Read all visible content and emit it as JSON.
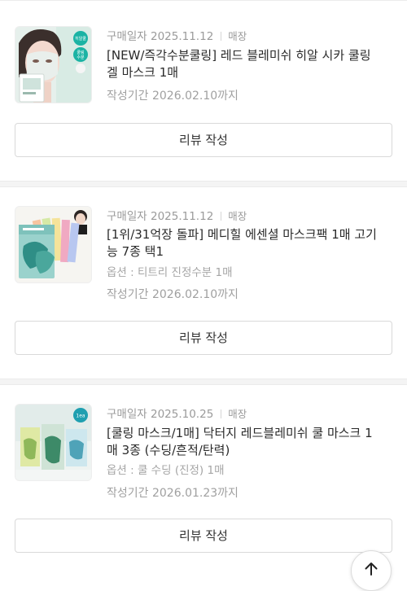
{
  "orders": [
    {
      "date_label": "구매일자",
      "date": "2025.11.12",
      "store": "매장",
      "title": "[NEW/즉각수분쿨링] 레드 블레미쉬 히알 시카 쿨링 겔 마스크 1매",
      "option": "",
      "period_label": "작성기간",
      "period": "2026.02.10까지",
      "review_button": "리뷰 작성",
      "thumb_badges": [
        "히알쿨",
        "쿨링",
        "수분"
      ]
    },
    {
      "date_label": "구매일자",
      "date": "2025.11.12",
      "store": "매장",
      "title": "[1위/31억장 돌파] 메디힐 에센셜 마스크팩 1매 고기능 7종 택1",
      "option": "옵션 : 티트리 진정수분 1매",
      "period_label": "작성기간",
      "period": "2026.02.10까지",
      "review_button": "리뷰 작성"
    },
    {
      "date_label": "구매일자",
      "date": "2025.10.25",
      "store": "매장",
      "title": "[쿨링 마스크/1매] 닥터지 레드블레미쉬 쿨 마스크 1매 3종 (수딩/흔적/탄력)",
      "option": "옵션 : 쿨 수딩 (진정) 1매",
      "period_label": "작성기간",
      "period": "2026.01.23까지",
      "review_button": "리뷰 작성",
      "thumb_badge": "1ea"
    }
  ],
  "scroll_top_icon": "arrow-up-icon"
}
